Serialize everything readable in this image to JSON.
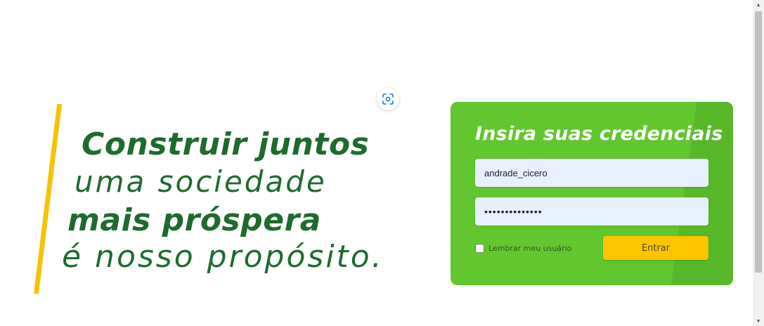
{
  "slogan": {
    "line1": "Construir juntos",
    "line2": "uma sociedade",
    "line3": "mais próspera",
    "line4": "é nosso propósito."
  },
  "icons": {
    "scan": "screenshot-scan-icon",
    "accent": "#1a73e8"
  },
  "login": {
    "title": "Insira suas credenciais",
    "username_value": "andrade_cicero",
    "password_value": "••••••••••••••",
    "remember_label": "Lembrar meu usuário",
    "remember_checked": false,
    "submit_label": "Entrar"
  },
  "colors": {
    "brand_green": "#62c62f",
    "dark_green": "#1e6b2e",
    "yellow": "#fdc500",
    "input_bg": "#e8f0fe"
  },
  "scrollbar": {
    "up_arrow": "▲",
    "down_arrow": "▼"
  }
}
